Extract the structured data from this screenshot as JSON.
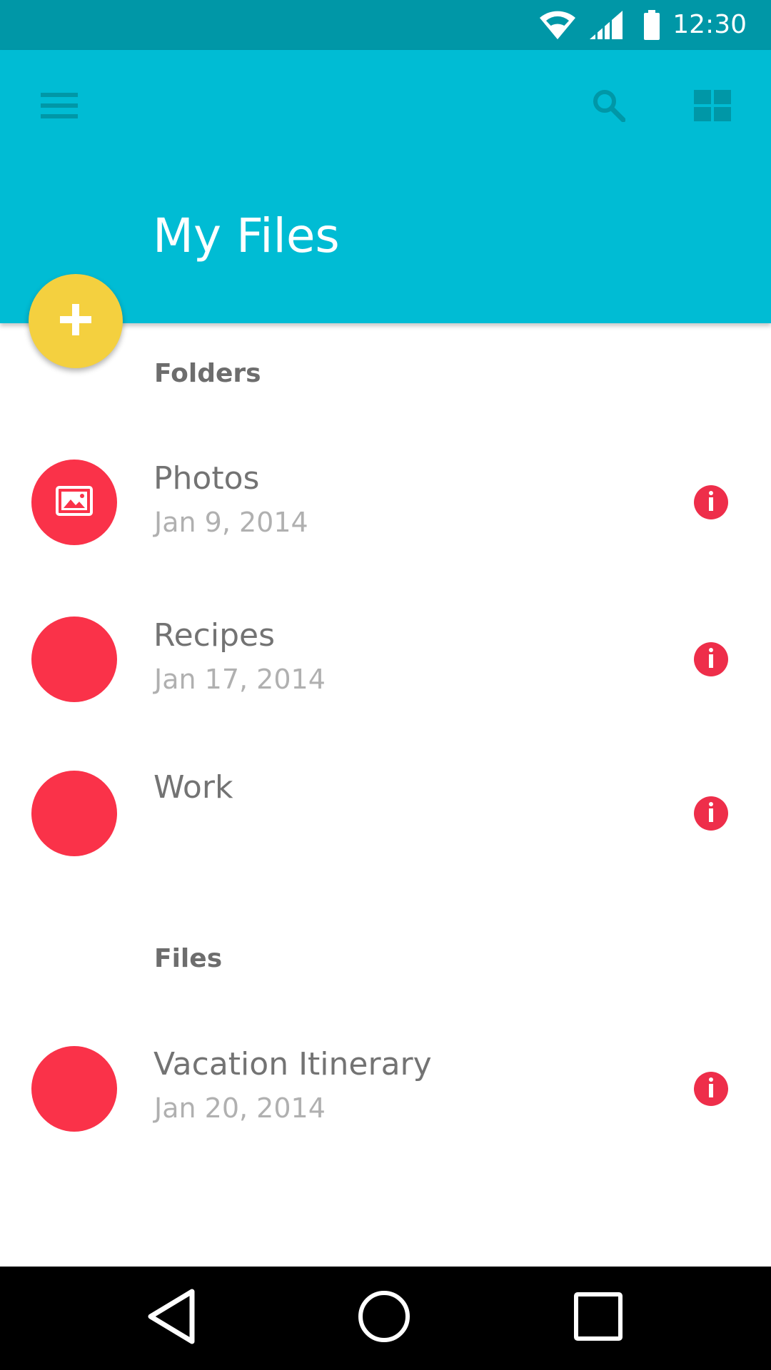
{
  "status_bar": {
    "time": "12:30",
    "icons": [
      "wifi-icon",
      "cellular-signal-icon",
      "battery-icon"
    ],
    "color": "#0097A7"
  },
  "app_bar": {
    "title": "My Files",
    "color": "#00BCD4",
    "actions": [
      "menu-icon",
      "search-icon",
      "grid-view-icon"
    ]
  },
  "fab": {
    "icon": "add-icon",
    "color": "#F4D03F"
  },
  "folders": {
    "header": "Folders",
    "items": [
      {
        "name": "Photos",
        "date": "Jan 9, 2014",
        "icon": "image-icon"
      },
      {
        "name": "Recipes",
        "date": "Jan 17, 2014"
      },
      {
        "name": "Work"
      }
    ]
  },
  "files": {
    "header": "Files",
    "items": [
      {
        "name": "Vacation Itinerary",
        "date": "Jan 20, 2014"
      }
    ]
  },
  "accent_color": "#FA3249",
  "nav_bar": {
    "buttons": [
      "back-icon",
      "home-icon",
      "recents-icon"
    ]
  }
}
